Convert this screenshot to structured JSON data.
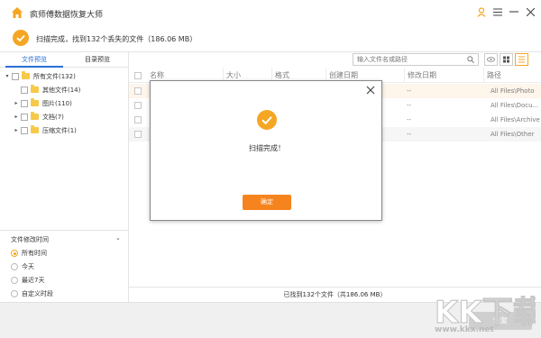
{
  "app": {
    "title": "疯师傅数据恢复大师",
    "accent": "#f5a623"
  },
  "window_controls": [
    "user-icon",
    "menu-icon",
    "minimize-icon",
    "close-icon"
  ],
  "status": {
    "text": "扫描完成，找到132个丢失的文件（186.06 MB）"
  },
  "sidebar": {
    "tabs": [
      {
        "label": "文件预览",
        "active": true
      },
      {
        "label": "目录预览",
        "active": false
      }
    ],
    "tree": [
      {
        "label": "所有文件(132)",
        "level": 0
      },
      {
        "label": "其他文件(14)",
        "level": 1
      },
      {
        "label": "图片(110)",
        "level": 1
      },
      {
        "label": "文档(7)",
        "level": 1
      },
      {
        "label": "压缩文件(1)",
        "level": 1
      }
    ]
  },
  "filter": {
    "title": "文件修改时间",
    "options": [
      {
        "label": "所有时间",
        "selected": true
      },
      {
        "label": "今天",
        "selected": false
      },
      {
        "label": "最近7天",
        "selected": false
      },
      {
        "label": "自定义时段",
        "selected": false
      }
    ]
  },
  "search": {
    "placeholder": "输入文件名或路径"
  },
  "table": {
    "headers": [
      "名称",
      "大小",
      "格式",
      "创建日期",
      "修改日期",
      "路径"
    ],
    "rows": [
      {
        "modified": "--",
        "path": "All Files\\Photo"
      },
      {
        "modified": "--",
        "path": "All Files\\Docu..."
      },
      {
        "modified": "--",
        "path": "All Files\\Archive"
      },
      {
        "modified": "--",
        "path": "All Files\\Other"
      }
    ]
  },
  "footer": {
    "text": "已找到132个文件（共186.06 MB）"
  },
  "bottom": {
    "recover_label": "恢复"
  },
  "dialog": {
    "message": "扫描完成！",
    "confirm_label": "确定"
  },
  "watermark": {
    "text": "KK下载",
    "url": "www.kkx.net"
  }
}
